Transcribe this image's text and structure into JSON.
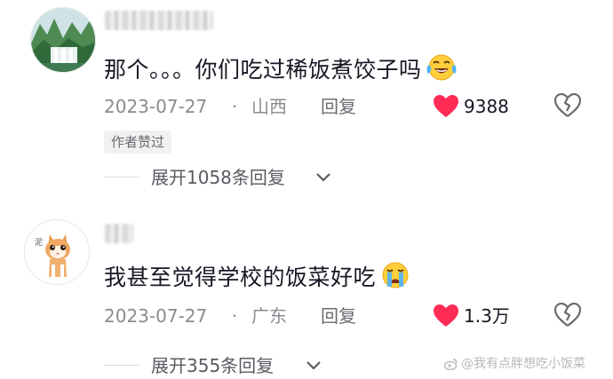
{
  "comments": [
    {
      "username": "",
      "text": "那个。。。你们吃过稀饭煮饺子吗",
      "emoji": "tears-of-joy-emoji",
      "date": "2023-07-27",
      "separator": "·",
      "location": "山西",
      "reply_label": "回复",
      "like_count": "9388",
      "author_tag": "作者赞过",
      "expand_label": "展开1058条回复"
    },
    {
      "username": "",
      "text": "我甚至觉得学校的饭菜好吃",
      "emoji": "crying-emoji",
      "date": "2023-07-27",
      "separator": "·",
      "location": "广东",
      "reply_label": "回复",
      "like_count": "1.3万",
      "expand_label": "展开355条回复"
    }
  ],
  "watermark": "@我有点胖想吃小饭菜",
  "colors": {
    "like_heart": "#fe2c55",
    "meta_text": "#8a8b91",
    "author_tag_bg": "#f1f1f2"
  },
  "icons": [
    "heart-icon",
    "broken-heart-icon",
    "chevron-down-icon",
    "weibo-icon"
  ]
}
